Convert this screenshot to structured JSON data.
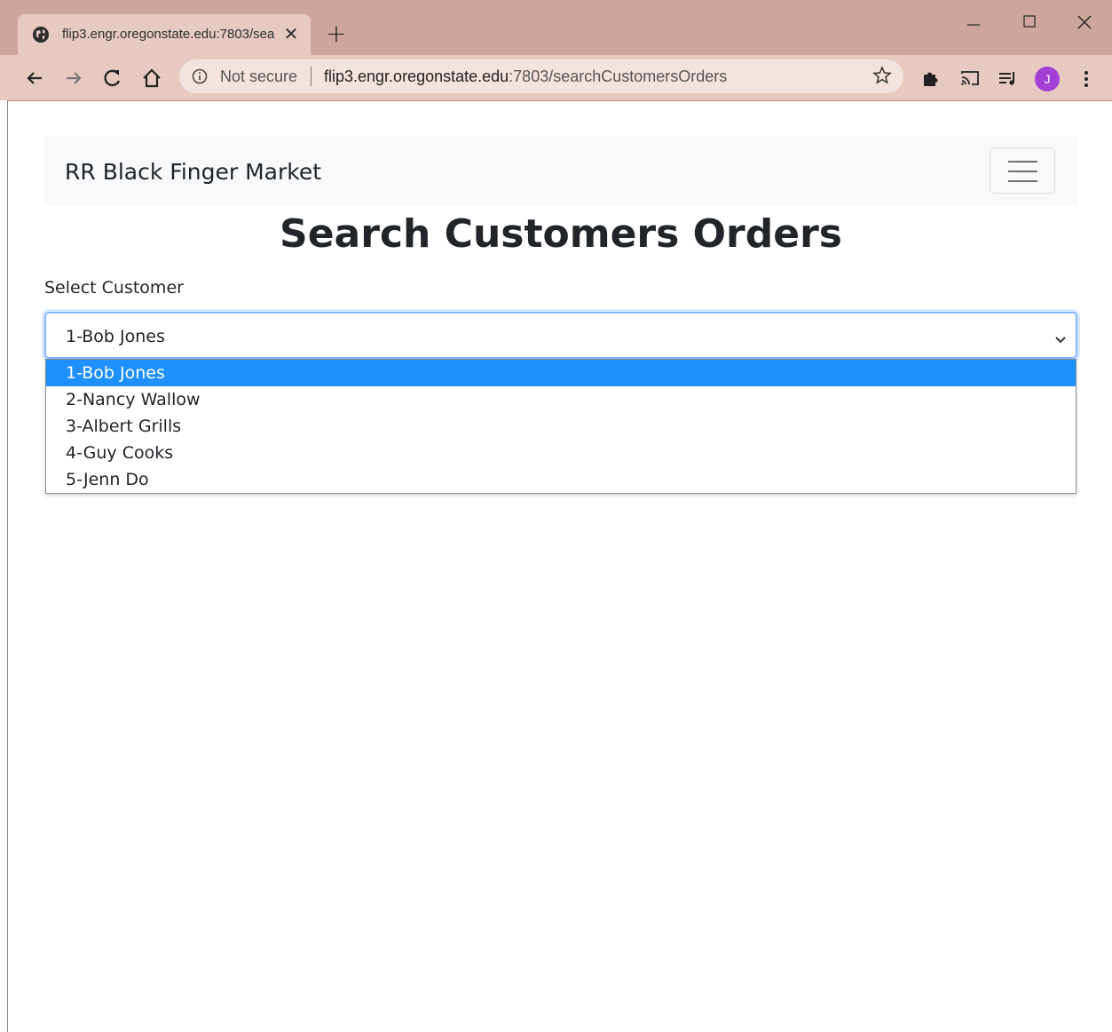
{
  "browser": {
    "tab_title": "flip3.engr.oregonstate.edu:7803/searchCustomersOrders",
    "tab_close": "✕",
    "new_tab": "+",
    "security_label": "Not secure",
    "url_host": "flip3.engr.oregonstate.edu",
    "url_rest": ":7803/searchCustomersOrders",
    "profile_initial": "J",
    "profile_color": "#a43fd6",
    "chrome_color": "#cea59b",
    "toolbar_color": "#e7c9c1"
  },
  "navbar": {
    "brand": "RR Black Finger Market"
  },
  "page": {
    "title": "Search Customers Orders",
    "select_label": "Select Customer",
    "selected_value": "1-Bob Jones",
    "options": [
      "1-Bob Jones",
      "2-Nancy Wallow",
      "3-Albert Grills",
      "4-Guy Cooks",
      "5-Jenn Do"
    ],
    "highlight_color": "#1e90ff"
  }
}
